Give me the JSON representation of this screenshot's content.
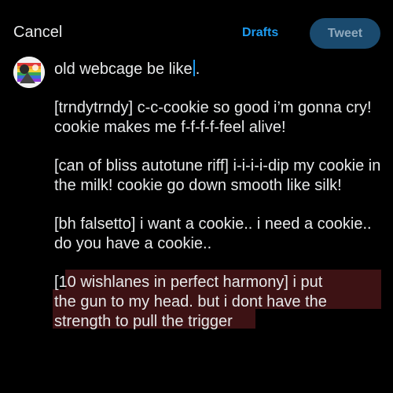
{
  "header": {
    "cancel_label": "Cancel",
    "drafts_label": "Drafts",
    "tweet_label": "Tweet"
  },
  "colors": {
    "accent": "#1d9bf0",
    "tweet_button_disabled": "#1a4a6e",
    "highlight": "#3d1214"
  },
  "compose": {
    "line1_before_caret": "old webcage be like",
    "line1_after_caret": ".",
    "para2": "[trndytrndy] c-c-cookie so good i’m gonna cry! cookie makes me f-f-f-f-feel alive!",
    "para3": "[can of bliss autotune riff] i-i-i-i-dip my cookie in the milk! cookie go down smooth like silk!",
    "para4": "[bh falsetto] i want a cookie.. i need a cookie.. do you have a cookie..",
    "para5_line1": "[10 wishlanes in perfect harmony] i put",
    "para5_line2": "the gun to my head. but i dont have the",
    "para5_line3": "strength to pull the trigger"
  }
}
